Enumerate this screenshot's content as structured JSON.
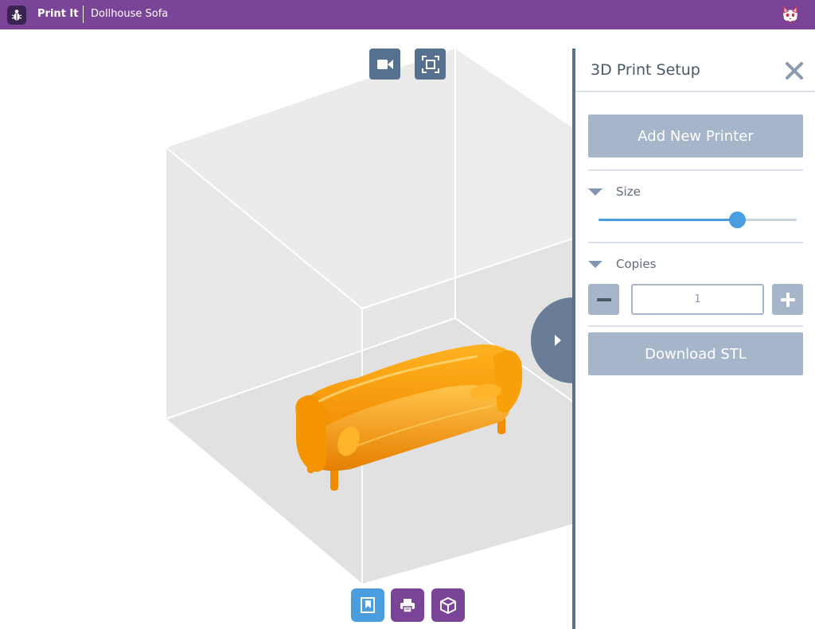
{
  "header": {
    "app_name": "Print It",
    "document_title": "Dollhouse Sofa",
    "brand_color": "#7b4597",
    "icons": {
      "logo": "bug-icon",
      "user": "cat-avatar-icon"
    }
  },
  "viewport": {
    "toolbar_icons": [
      "video-camera-icon",
      "fit-view-icon"
    ],
    "bottom_buttons": [
      {
        "icon": "model-view-icon",
        "color": "#4a9ee0",
        "active": true
      },
      {
        "icon": "printer-icon",
        "color": "#7b4597",
        "active": false
      },
      {
        "icon": "cube-icon",
        "color": "#7b4597",
        "active": false
      }
    ],
    "collapse_icon": "chevron-right-icon",
    "model_color": "#ff9900"
  },
  "panel": {
    "title": "3D Print Setup",
    "close_icon": "close-icon",
    "add_printer_label": "Add New Printer",
    "size_section": {
      "label": "Size",
      "slider_fraction": 0.7
    },
    "copies_section": {
      "label": "Copies",
      "value": "1",
      "decrement_icon": "minus-icon",
      "increment_icon": "plus-icon"
    },
    "download_label": "Download STL",
    "accent_color": "#4a9ee0",
    "button_color": "#a6b5c9"
  }
}
